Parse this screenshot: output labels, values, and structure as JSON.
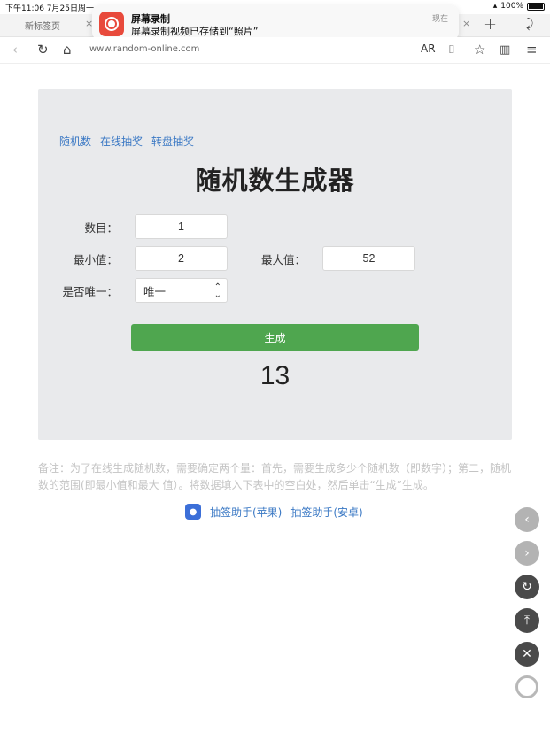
{
  "status": {
    "time": "下午11:06  7月25日周一",
    "battery": "100%"
  },
  "tabs": {
    "current_tab": "新标签页"
  },
  "notification": {
    "title": "屏幕录制",
    "body": "屏幕录制视频已存储到“照片”",
    "time": "现在"
  },
  "address": {
    "url": "www.random-online.com",
    "ar_label": "AR"
  },
  "nav_links": [
    "随机数",
    "在线抽奖",
    "转盘抽奖"
  ],
  "page_title": "随机数生成器",
  "form": {
    "count_label": "数目：",
    "count_value": "1",
    "min_label": "最小值：",
    "min_value": "2",
    "max_label": "最大值：",
    "max_value": "52",
    "unique_label": "是否唯一：",
    "unique_value": "唯一",
    "generate_label": "生成"
  },
  "result": "13",
  "note": "备注：为了在线生成随机数，需要确定两个量：首先，需要生成多少个随机数（即数字）；第二，随机数的范围(即最小值和最大 值）。将数据填入下表中的空白处，然后单击“生成”生成。",
  "helpers": {
    "ios": "抽签助手(苹果)",
    "android": "抽签助手(安卓)"
  },
  "colors": {
    "accent_link": "#3a78c4",
    "generate_button": "#4fa64f",
    "card_bg": "#e9eaec",
    "notification_icon": "#e84a3c"
  }
}
